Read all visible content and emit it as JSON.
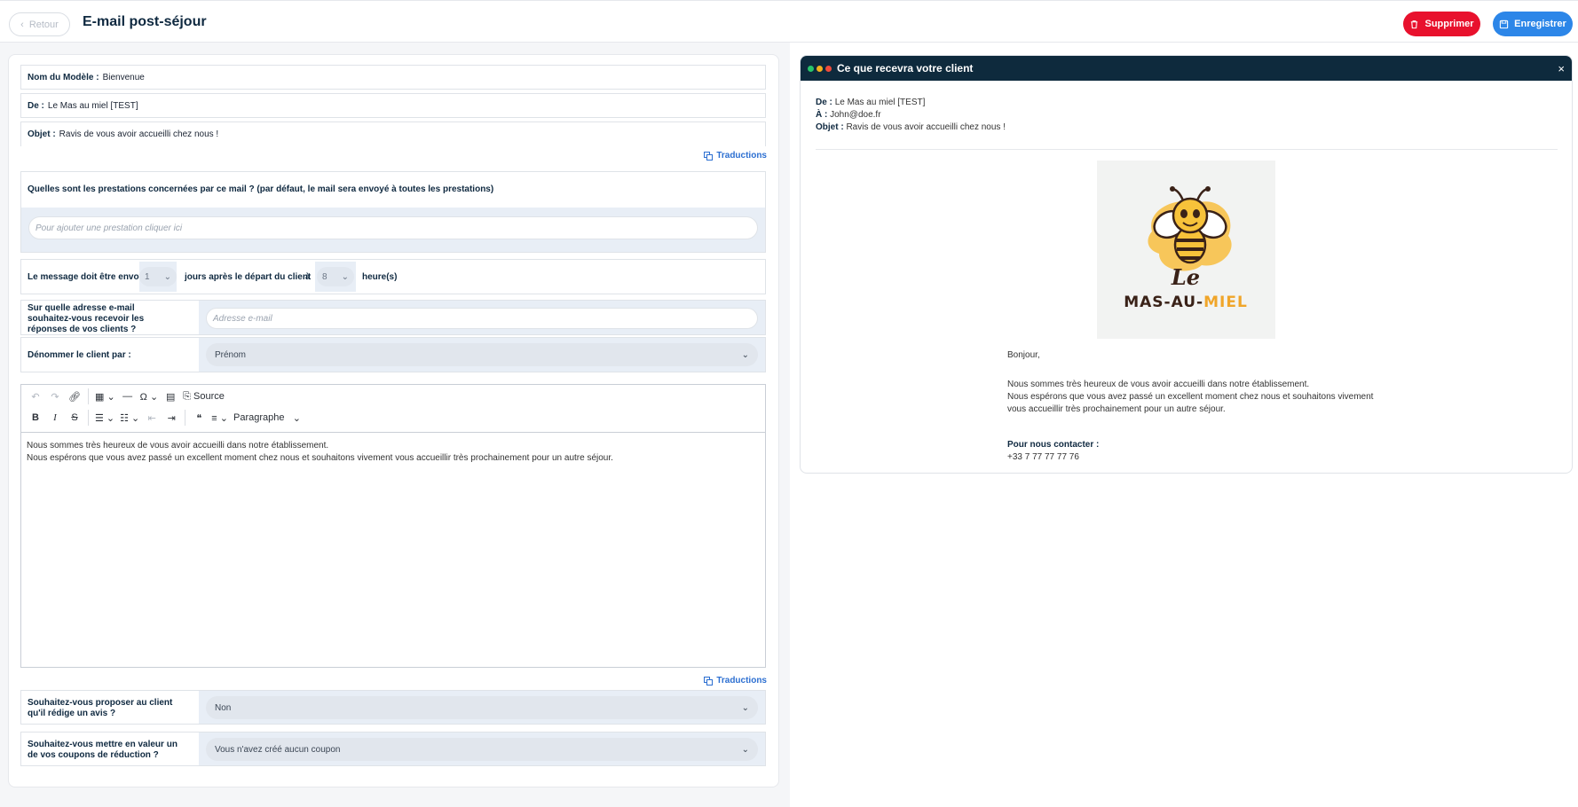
{
  "header": {
    "back_label": "Retour",
    "title": "E-mail post-séjour",
    "delete_label": "Supprimer",
    "save_label": "Enregistrer"
  },
  "form": {
    "model_name_label": "Nom du Modèle :",
    "model_name_value": "Bienvenue",
    "from_label": "De :",
    "from_value": "Le Mas au miel [TEST]",
    "subject_label": "Objet :",
    "subject_value": "Ravis de vous avoir accueilli chez nous !",
    "translations_label": "Traductions",
    "services_question": "Quelles sont les prestations concernées par ce mail ? (par défaut, le mail sera envoyé à toutes les prestations)",
    "services_placeholder": "Pour ajouter une prestation cliquer ici",
    "schedule": {
      "prefix": "Le message doit être envoyé",
      "days_value": "1",
      "middle": "jours après le départ du client",
      "at": "à",
      "hour_value": "8",
      "suffix": "heure(s)"
    },
    "reply_question": "Sur quelle adresse e-mail souhaitez-vous recevoir les réponses de vos clients ?",
    "reply_placeholder": "Adresse e-mail",
    "name_client_label": "Dénommer le client par :",
    "name_client_value": "Prénom",
    "review_question": "Souhaitez-vous proposer au client qu'il rédige un avis ?",
    "review_value": "Non",
    "coupon_question": "Souhaitez-vous mettre en valeur un de vos coupons de réduction ?",
    "coupon_value": "Vous n'avez créé aucun coupon"
  },
  "editor": {
    "source_label": "Source",
    "paragraph_label": "Paragraphe",
    "line1": "Nous sommes très heureux de vous avoir accueilli dans notre établissement.",
    "line2": "Nous espérons que vous avez passé un excellent moment chez nous et souhaitons vivement vous accueillir très prochainement pour un autre séjour."
  },
  "preview": {
    "title": "Ce que recevra votre client",
    "from_label": "De :",
    "from_value": "Le Mas au miel [TEST]",
    "to_label": "À :",
    "to_value": "John@doe.fr",
    "subject_label": "Objet :",
    "subject_value": "Ravis de vous avoir accueilli chez nous !",
    "logo_le": "Le",
    "logo_mas": "MAS-AU-",
    "logo_miel": "MIEL",
    "greeting": "Bonjour,",
    "line1": "Nous sommes très heureux de vous avoir accueilli dans notre établissement.",
    "line2": "Nous espérons que vous avez passé un excellent moment chez nous et souhaitons vivement vous accueillir très prochainement pour un autre séjour.",
    "contact_label": "Pour nous contacter :",
    "phone": "+33 7 77 77 77 76"
  },
  "colors": {
    "accent_blue": "#2c86e8",
    "danger_red": "#e8112d",
    "header_dark": "#0e2a3d"
  }
}
